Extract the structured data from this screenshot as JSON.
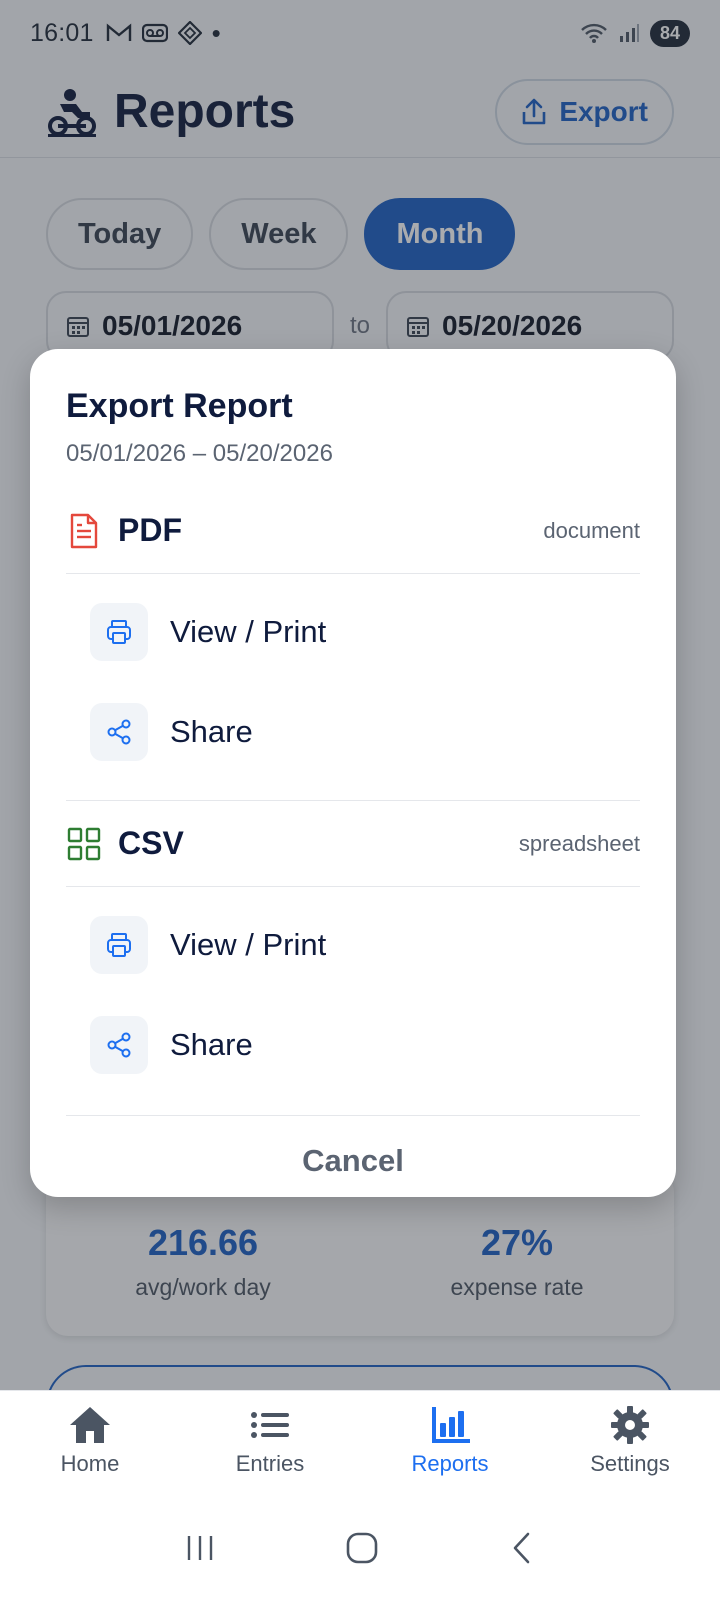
{
  "status_bar": {
    "time": "16:01",
    "battery": "84"
  },
  "header": {
    "title": "Reports",
    "export_label": "Export"
  },
  "range_chips": [
    {
      "label": "Today",
      "active": false
    },
    {
      "label": "Week",
      "active": false
    },
    {
      "label": "Month",
      "active": true
    }
  ],
  "date_range": {
    "from": "05/01/2026",
    "to_word": "to",
    "to": "05/20/2026"
  },
  "stats": [
    {
      "value": "216.66",
      "label": "avg/work day"
    },
    {
      "value": "27%",
      "label": "expense rate"
    }
  ],
  "export_modal": {
    "title": "Export Report",
    "subtitle": "05/01/2026 – 05/20/2026",
    "pdf": {
      "name": "PDF",
      "type": "document",
      "view_label": "View / Print",
      "share_label": "Share"
    },
    "csv": {
      "name": "CSV",
      "type": "spreadsheet",
      "view_label": "View / Print",
      "share_label": "Share"
    },
    "cancel_label": "Cancel"
  },
  "bottom_nav": [
    {
      "label": "Home",
      "icon": "home-icon",
      "active": false
    },
    {
      "label": "Entries",
      "icon": "list-icon",
      "active": false
    },
    {
      "label": "Reports",
      "icon": "bar-chart-icon",
      "active": true
    },
    {
      "label": "Settings",
      "icon": "gear-icon",
      "active": false
    }
  ],
  "colors": {
    "accent": "#1d5fc4",
    "nav_active": "#1d6ff0",
    "pdf_icon": "#e4483c",
    "csv_icon": "#2e7d32",
    "option_icon": "#1d6ff0"
  }
}
